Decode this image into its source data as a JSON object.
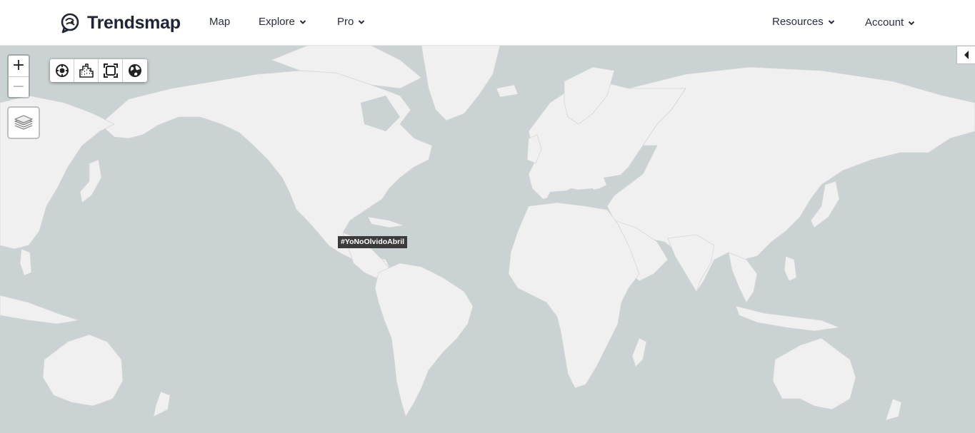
{
  "header": {
    "brand": "Trendsmap",
    "nav": [
      {
        "label": "Map",
        "has_menu": false
      },
      {
        "label": "Explore",
        "has_menu": true
      },
      {
        "label": "Pro",
        "has_menu": true
      },
      {
        "label": "Resources",
        "has_menu": true
      },
      {
        "label": "Account",
        "has_menu": true
      }
    ]
  },
  "map": {
    "zoom_in_label": "+",
    "zoom_out_label": "−",
    "tools": [
      "locate-icon",
      "city-icon",
      "fullscreen-icon",
      "globe-icon"
    ],
    "layers_icon": "layers-icon",
    "panel_toggle_icon": "caret-left-icon",
    "colors": {
      "water": "#cad2d3",
      "land": "#f0f0f0",
      "border": "#d2d2d2",
      "trend_bg": "#3b3b3b"
    },
    "trends": [
      {
        "tag": "#YoNoOlvidoAbril"
      }
    ]
  }
}
